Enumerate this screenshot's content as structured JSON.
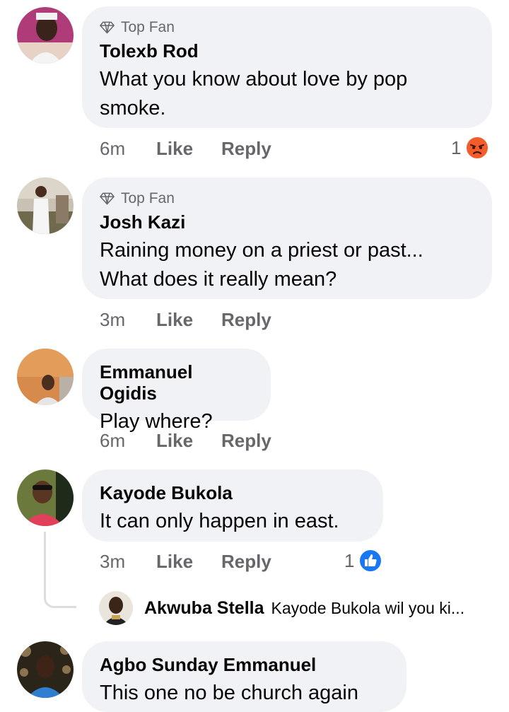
{
  "comments": [
    {
      "badge": "Top Fan",
      "author": "Tolexb Rod",
      "text": "What you know about love by pop smoke.",
      "time": "6m",
      "like_label": "Like",
      "reply_label": "Reply",
      "reaction_count": "1",
      "reaction_icon": "angry-reaction-icon"
    },
    {
      "badge": "Top Fan",
      "author": "Josh Kazi",
      "text": "Raining money on a priest or past... What does it really mean?",
      "time": "3m",
      "like_label": "Like",
      "reply_label": "Reply"
    },
    {
      "author": "Emmanuel Ogidis",
      "text": "Play where?",
      "time": "6m",
      "like_label": "Like",
      "reply_label": "Reply"
    },
    {
      "author": "Kayode Bukola",
      "text": "It can only happen in east.",
      "time": "3m",
      "like_label": "Like",
      "reply_label": "Reply",
      "reaction_count": "1",
      "reaction_icon": "like-reaction-icon"
    },
    {
      "author": "Agbo Sunday Emmanuel",
      "text": "This one no be church again"
    }
  ],
  "reply_preview": {
    "author": "Akwuba Stella",
    "text": "Kayode Bukola wil you ki..."
  },
  "colors": {
    "bubble": "#f0f2f5",
    "secondary_text": "#65676b",
    "like_blue": "#1877f2",
    "angry_orange": "#f25d2b"
  }
}
